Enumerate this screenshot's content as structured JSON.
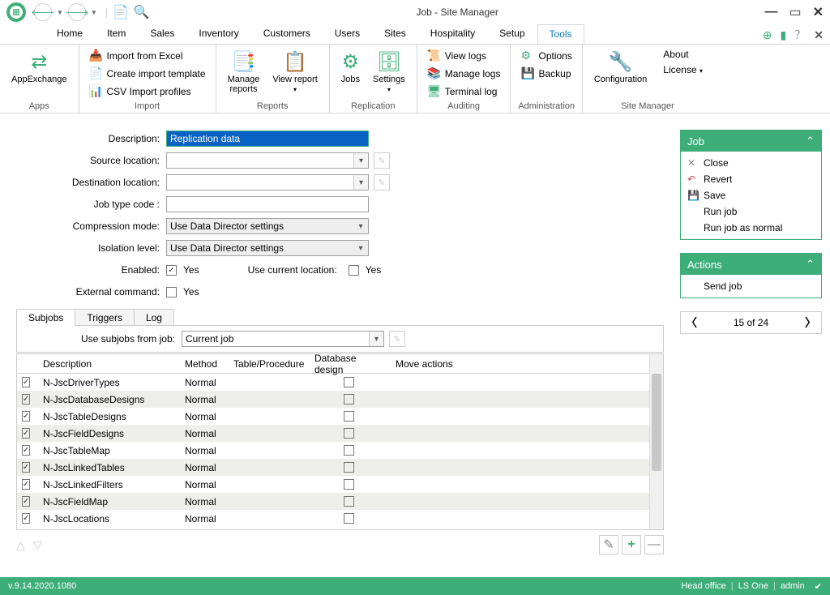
{
  "title": "Job - Site Manager",
  "menus": [
    "Home",
    "Item",
    "Sales",
    "Inventory",
    "Customers",
    "Users",
    "Sites",
    "Hospitality",
    "Setup",
    "Tools"
  ],
  "activeMenu": "Tools",
  "ribbon": {
    "apps": {
      "label": "Apps",
      "btn": "AppExchange"
    },
    "import": {
      "label": "Import",
      "items": [
        "Import from Excel",
        "Create import template",
        "CSV Import profiles"
      ]
    },
    "reports": {
      "label": "Reports",
      "manage": "Manage\nreports",
      "view": "View report"
    },
    "replication": {
      "label": "Replication",
      "jobs": "Jobs",
      "settings": "Settings"
    },
    "auditing": {
      "label": "Auditing",
      "items": [
        "View logs",
        "Manage logs",
        "Terminal log"
      ]
    },
    "admin": {
      "label": "Administration",
      "items": [
        "Options",
        "Backup"
      ]
    },
    "siteManager": {
      "label": "Site Manager",
      "config": "Configuration",
      "about": "About",
      "license": "License"
    }
  },
  "form": {
    "descriptionLabel": "Description:",
    "description": "Replication data",
    "sourceLabel": "Source location:",
    "source": "",
    "destLabel": "Destination location:",
    "dest": "",
    "jobTypeLabel": "Job type code :",
    "jobType": "",
    "compressionLabel": "Compression mode:",
    "compression": "Use Data Director settings",
    "isolationLabel": "Isolation level:",
    "isolation": "Use Data Director settings",
    "enabledLabel": "Enabled:",
    "yes": "Yes",
    "useCurrentLabel": "Use current location:",
    "externalLabel": "External command:"
  },
  "jobPanel": {
    "title": "Job",
    "items": [
      "Close",
      "Revert",
      "Save",
      "Run job",
      "Run job as normal"
    ]
  },
  "actionsPanel": {
    "title": "Actions",
    "items": [
      "Send job"
    ]
  },
  "pager": "15 of 24",
  "tabs": [
    "Subjobs",
    "Triggers",
    "Log"
  ],
  "subjobsFromLabel": "Use subjobs from job:",
  "subjobsFrom": "Current job",
  "grid": {
    "headers": {
      "desc": "Description",
      "method": "Method",
      "table": "Table/Procedure",
      "db": "Database design",
      "move": "Move actions"
    },
    "rows": [
      {
        "desc": "N-JscDriverTypes",
        "method": "Normal",
        "alt": false
      },
      {
        "desc": "N-JscDatabaseDesigns",
        "method": "Normal",
        "alt": true
      },
      {
        "desc": "N-JscTableDesigns",
        "method": "Normal",
        "alt": false
      },
      {
        "desc": "N-JscFieldDesigns",
        "method": "Normal",
        "alt": true
      },
      {
        "desc": "N-JscTableMap",
        "method": "Normal",
        "alt": false
      },
      {
        "desc": "N-JscLinkedTables",
        "method": "Normal",
        "alt": true
      },
      {
        "desc": "N-JscLinkedFilters",
        "method": "Normal",
        "alt": false
      },
      {
        "desc": "N-JscFieldMap",
        "method": "Normal",
        "alt": true
      },
      {
        "desc": "N-JscLocations",
        "method": "Normal",
        "alt": false
      }
    ]
  },
  "status": {
    "version": "v.9.14.2020.1080",
    "site": "Head office",
    "product": "LS One",
    "user": "admin"
  }
}
